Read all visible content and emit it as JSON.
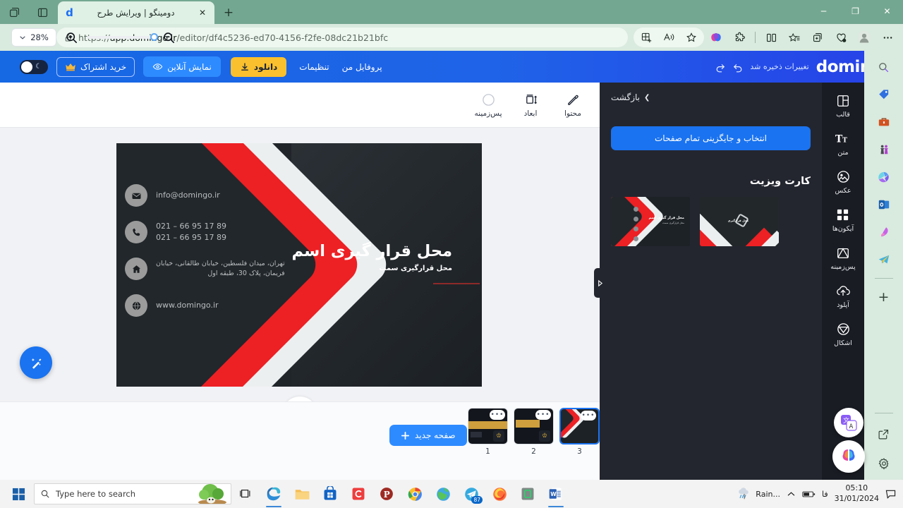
{
  "browser": {
    "tab": {
      "title": "دومینگو | ویرایش طرح",
      "favicon": "d",
      "close": "✕"
    },
    "new_tab": "+",
    "window_controls": {
      "minimize": "─",
      "maximize": "❐",
      "close": "✕"
    },
    "url_prefix": "https://",
    "url_main": "app.domingo.ir",
    "url_rest": "/editor/df4c5236-ed70-4156-f2fe-08dc21b21bfc",
    "nav": {
      "back": "←",
      "reload": "⟳",
      "lock": "lock-icon"
    },
    "toolbar_icons": [
      "collections-icon",
      "read-aloud-icon",
      "favorite-icon",
      "copilot-icon",
      "extensions-icon",
      "split-screen-icon",
      "favorites-list-icon",
      "add-collection-icon",
      "health-icon",
      "profile-icon",
      "settings-more-icon"
    ]
  },
  "app_header": {
    "logo": "domingo",
    "saved_text": "تغییرات ذخیره شد",
    "undo": "undo-icon",
    "redo": "redo-icon",
    "profile_link": "پروفایل من",
    "settings_link": "تنظیمات",
    "download_button": "دانلود",
    "preview_button": "نمایش آنلاین",
    "subscribe_button": "خرید اشتراک",
    "dark_toggle": "dark-mode-toggle"
  },
  "toolbar": {
    "items": [
      {
        "label": "محتوا",
        "icon": "edit-pencil-icon"
      },
      {
        "label": "ابعاد",
        "icon": "dimensions-icon"
      },
      {
        "label": "پس‌زمینه",
        "icon": "background-circle-icon"
      }
    ]
  },
  "canvas": {
    "card": {
      "name": "محل قرار گیری اسم",
      "subtitle": "محل قرارگیری سمت",
      "contacts": [
        {
          "icon": "mail-icon",
          "lines": [
            "info@domingo.ir"
          ]
        },
        {
          "icon": "phone-icon",
          "lines": [
            "021 – 66 95 17 89",
            "021 – 66 95 17 89"
          ]
        },
        {
          "icon": "home-icon",
          "lines": [
            "تهران، میدان فلسطین، خیابان طالقانی، خیابان",
            "فریمان، پلاک 30، طبقه اول"
          ],
          "rtl": true
        },
        {
          "icon": "globe-icon",
          "lines": [
            "www.domingo.ir"
          ]
        }
      ],
      "colors": {
        "red": "#ed2024",
        "white": "#eceff0",
        "dark": "#22272b"
      }
    },
    "magic_button": "magic-wand-icon",
    "scroll_down": "chevron-down-icon"
  },
  "bottom": {
    "zoom_value": "28%",
    "zoom_in": "zoom-in-icon",
    "zoom_out": "zoom-out-icon",
    "new_page_button": "صفحه جدید",
    "pages": [
      {
        "number": "1",
        "premium": true,
        "selected": false
      },
      {
        "number": "2",
        "premium": true,
        "selected": false
      },
      {
        "number": "3",
        "premium": false,
        "selected": true
      }
    ]
  },
  "panel": {
    "back_label": "بازگشت",
    "back_chevron": "❯",
    "replace_all_button": "انتخاب و جایگزینی تمام صفحات",
    "section_title": "کارت ویزیت",
    "templates": [
      {
        "name": "template-chevron-card"
      },
      {
        "name": "template-diagonal-card"
      }
    ],
    "collapse_handle": "▷"
  },
  "sidebar": {
    "items": [
      {
        "label": "قالب",
        "icon": "template-icon"
      },
      {
        "label": "متن",
        "icon": "text-icon"
      },
      {
        "label": "عکس",
        "icon": "image-icon"
      },
      {
        "label": "آیکون‌ها",
        "icon": "icons-grid-icon"
      },
      {
        "label": "پس‌زمینه",
        "icon": "background-icon"
      },
      {
        "label": "آپلود",
        "icon": "upload-cloud-icon"
      },
      {
        "label": "اشکال",
        "icon": "shapes-icon"
      }
    ]
  },
  "edge_sidebar": {
    "icons": [
      "search-icon",
      "shopping-icon",
      "tools-icon",
      "games-icon",
      "office-icon",
      "outlook-icon",
      "designer-icon",
      "telegram-icon"
    ],
    "add": "+",
    "bottom_icons": [
      "open-pane-icon",
      "sidebar-settings-icon"
    ]
  },
  "floating": {
    "translate": "translate-icon",
    "copilot": "copilot-brain-icon"
  },
  "taskbar": {
    "start": "windows-start-icon",
    "search_placeholder": "Type here to search",
    "task_view": "task-view-icon",
    "apps": [
      "edge-icon",
      "file-explorer-icon",
      "store-icon",
      "c-app-icon",
      "p-app-icon",
      "chrome-icon",
      "globe-app-icon",
      "telegram-icon",
      "firefox-icon",
      "green-app-icon",
      "word-icon"
    ],
    "telegram_badge": "87",
    "weather": "Rain...",
    "tray": [
      "show-hidden-icon",
      "battery-icon",
      "language-icon"
    ],
    "language": "فا",
    "time": "05:10",
    "date": "31/01/2024",
    "notifications": "notification-icon"
  }
}
